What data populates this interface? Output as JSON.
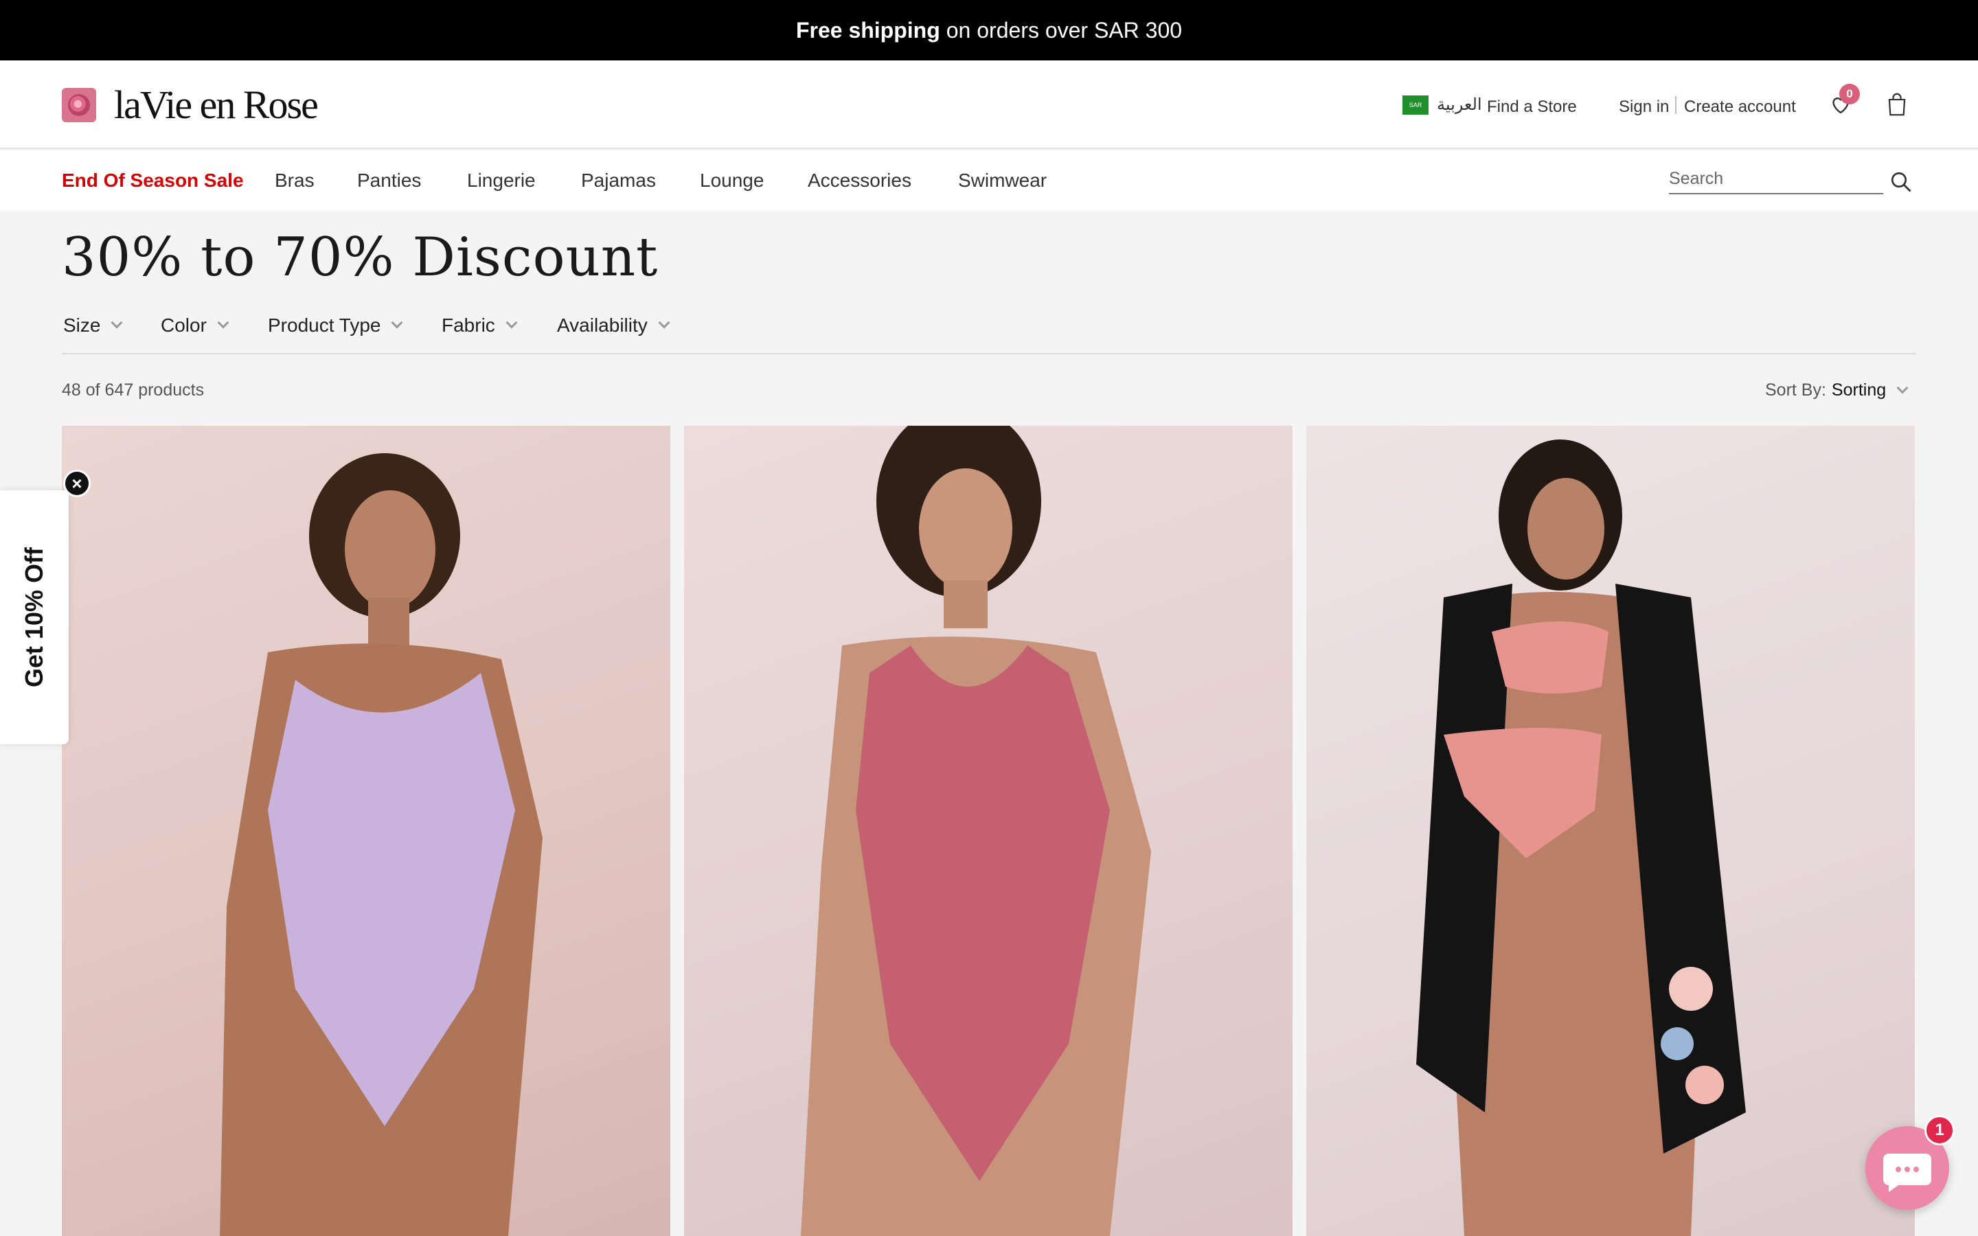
{
  "announcement": {
    "bold": "Free shipping",
    "rest": "on orders over SAR 300"
  },
  "header": {
    "logo_text": "laVie en Rose",
    "language": {
      "flag_text": "SAR",
      "label": "العربية"
    },
    "find_store": "Find a Store",
    "sign_in": "Sign in",
    "create_account": "Create account",
    "wishlist_count": "0"
  },
  "nav": {
    "items": [
      "End Of Season Sale",
      "Bras",
      "Panties",
      "Lingerie",
      "Pajamas",
      "Lounge",
      "Accessories",
      "Swimwear"
    ],
    "search_placeholder": "Search"
  },
  "page": {
    "title": "30% to 70% Discount",
    "filters": [
      "Size",
      "Color",
      "Product Type",
      "Fabric",
      "Availability"
    ],
    "count": "48 of 647 products",
    "sort_label": "Sort By:",
    "sort_value": "Sorting"
  },
  "products": [
    {
      "swimsuit_color": "#c9b3dd"
    },
    {
      "swimsuit_color": "#c46070"
    },
    {
      "swimsuit_color": "#e8948e"
    }
  ],
  "popup": {
    "label": "Get 10% Off",
    "close": "×"
  },
  "chat": {
    "badge": "1"
  },
  "colors": {
    "sale": "#d80000",
    "badge": "#d9607b",
    "chat": "#ec87a9"
  }
}
